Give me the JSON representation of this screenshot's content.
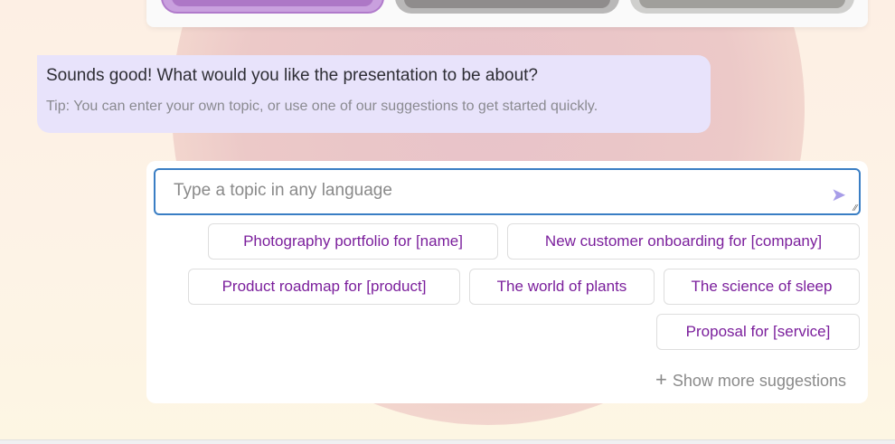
{
  "message": {
    "question": "Sounds good! What would you like the presentation to be about?",
    "tip": "Tip: You can enter your own topic, or use one of our suggestions to get started quickly."
  },
  "input": {
    "placeholder": "Type a topic in any language",
    "value": ""
  },
  "suggestions": [
    "Photography portfolio for [name]",
    "New customer onboarding for [company]",
    "Product roadmap for [product]",
    "The world of plants",
    "The science of sleep",
    "Proposal for [service]"
  ],
  "show_more": "Show more suggestions",
  "colors": {
    "accent": "#7b1f9c",
    "input_border": "#3a7ec4",
    "bubble": "#e8e3fb"
  }
}
